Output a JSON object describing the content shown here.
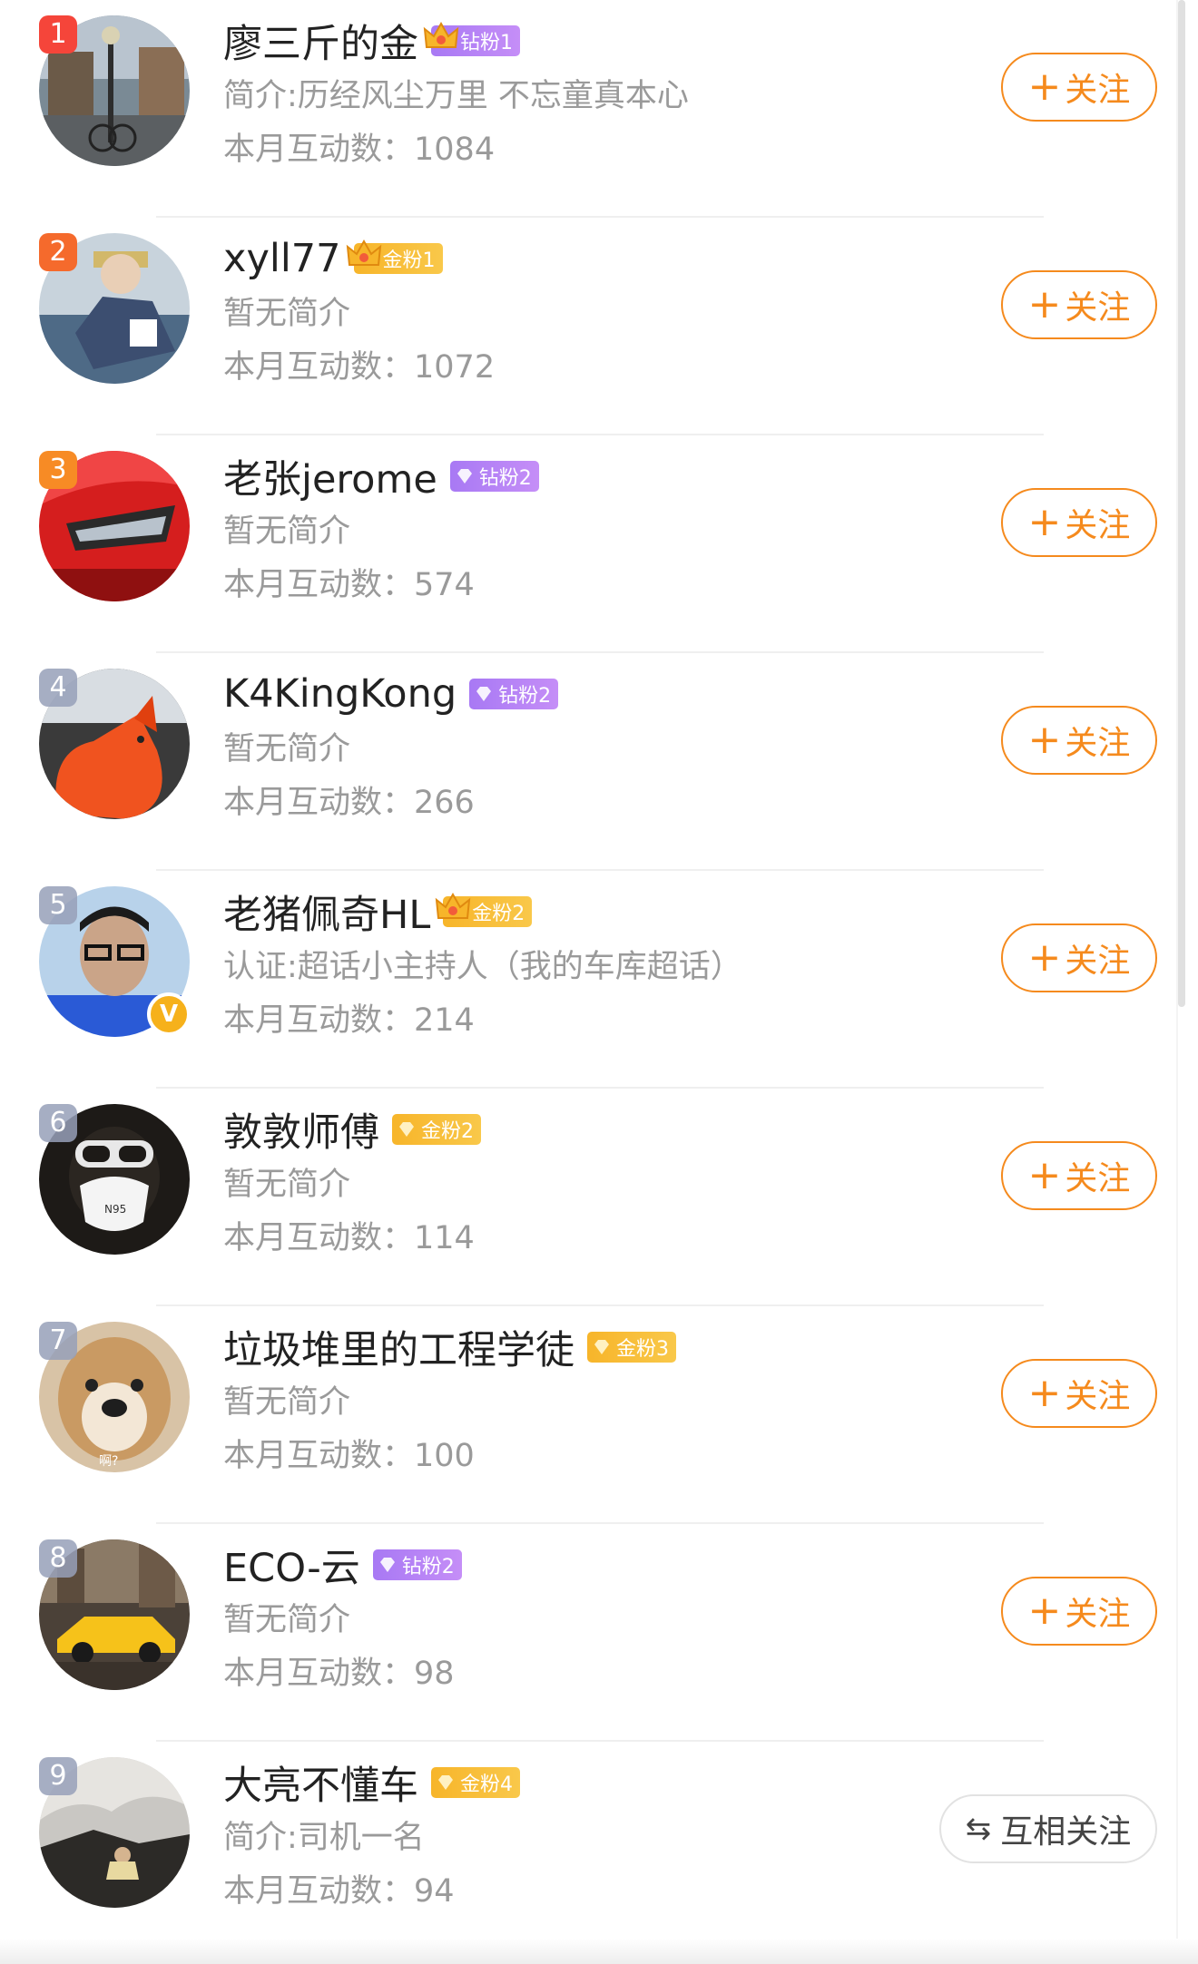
{
  "list": {
    "count_label": "本月互动数：",
    "follow_label": "关注",
    "follow_plus": "+",
    "mutual_label": "互相关注",
    "mutual_icon": "⇆",
    "items": [
      {
        "rank": "1",
        "name": "廖三斤的金",
        "badge": "钻粉1",
        "badge_type": "crown-diamond",
        "desc": "简介:历经风尘万里 不忘童真本心",
        "count": "1084",
        "action": "follow"
      },
      {
        "rank": "2",
        "name": "xyll77",
        "badge": "金粉1",
        "badge_type": "crown-gold",
        "desc": "暂无简介",
        "count": "1072",
        "action": "follow"
      },
      {
        "rank": "3",
        "name": "老张jerome",
        "badge": "钻粉2",
        "badge_type": "diamond",
        "desc": "暂无简介",
        "count": "574",
        "action": "follow"
      },
      {
        "rank": "4",
        "name": "K4KingKong",
        "badge": "钻粉2",
        "badge_type": "diamond",
        "desc": "暂无简介",
        "count": "266",
        "action": "follow"
      },
      {
        "rank": "5",
        "name": "老猪佩奇HL",
        "badge": "金粉2",
        "badge_type": "crown-gold",
        "desc": "认证:超话小主持人（我的车库超话）",
        "count": "214",
        "action": "follow",
        "verified": "V"
      },
      {
        "rank": "6",
        "name": "敦敦师傅",
        "badge": "金粉2",
        "badge_type": "gold",
        "desc": "暂无简介",
        "count": "114",
        "action": "follow",
        "avatar_text": "N95"
      },
      {
        "rank": "7",
        "name": "垃圾堆里的工程学徒",
        "badge": "金粉3",
        "badge_type": "gold",
        "desc": "暂无简介",
        "count": "100",
        "action": "follow",
        "avatar_text": "啊?"
      },
      {
        "rank": "8",
        "name": "ECO-云",
        "badge": "钻粉2",
        "badge_type": "diamond",
        "desc": "暂无简介",
        "count": "98",
        "action": "follow"
      },
      {
        "rank": "9",
        "name": "大亮不懂车",
        "badge": "金粉4",
        "badge_type": "gold",
        "desc": "简介:司机一名",
        "count": "94",
        "action": "mutual"
      }
    ]
  },
  "colors": {
    "accent": "#f58a1d",
    "rank1": "#f5453a",
    "rank2": "#f56a2c",
    "rank3": "#f78b25",
    "diamond_badge": "#b57ff5",
    "gold_badge": "#f7b52a"
  }
}
